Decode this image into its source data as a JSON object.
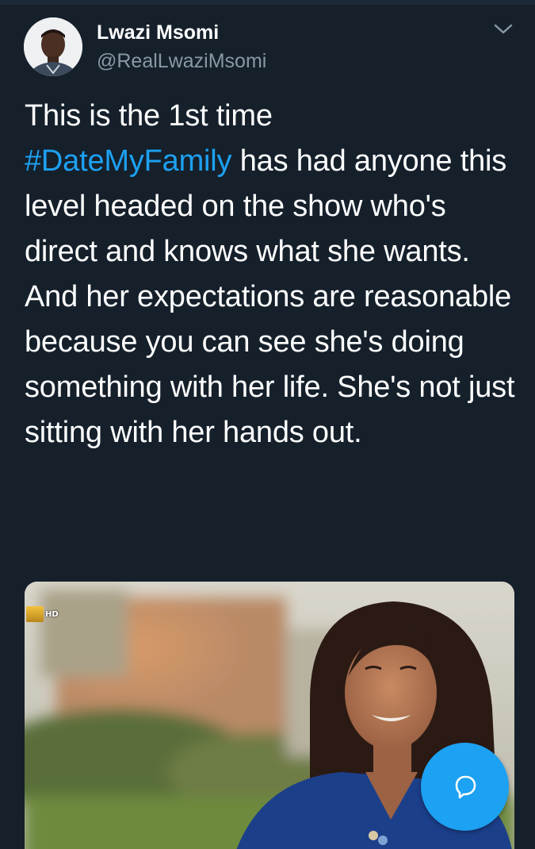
{
  "author": {
    "name": "Lwazi Msomi",
    "handle": "@RealLwaziMsomi"
  },
  "tweet": {
    "line1": "This is the 1st time",
    "hashtag": "#DateMyFamily",
    "rest": " has had anyone this level headed on the show who's direct and knows what she wants. And her expectations are reasonable because you can see she's doing something with her life. She's not just sitting with her hands out."
  },
  "media": {
    "badge_text": "HD"
  },
  "icons": {
    "more": "chevron-down-icon",
    "compose_reply": "speech-bubble-icon"
  },
  "colors": {
    "background": "#15202b",
    "text": "#ffffff",
    "secondary_text": "#8899a6",
    "accent": "#1da1f2"
  }
}
